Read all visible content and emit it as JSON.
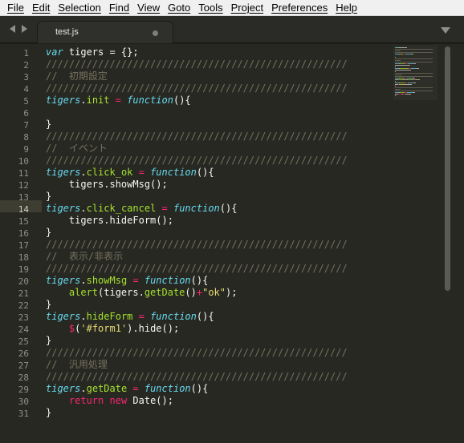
{
  "menu": [
    "File",
    "Edit",
    "Selection",
    "Find",
    "View",
    "Goto",
    "Tools",
    "Project",
    "Preferences",
    "Help"
  ],
  "tab": {
    "title": "test.js"
  },
  "current_line": 14,
  "lines": [
    {
      "n": "1",
      "t": [
        [
          "var",
          "kw"
        ],
        [
          " tigers = {};",
          ""
        ]
      ]
    },
    {
      "n": "2",
      "t": [
        [
          "////////////////////////////////////////////////////",
          "cm"
        ]
      ]
    },
    {
      "n": "3",
      "t": [
        [
          "//  初期設定",
          "cm"
        ]
      ]
    },
    {
      "n": "4",
      "t": [
        [
          "////////////////////////////////////////////////////",
          "cm"
        ]
      ]
    },
    {
      "n": "5",
      "t": [
        [
          "tigers",
          "obj"
        ],
        [
          ".",
          ""
        ],
        [
          "init",
          "fn"
        ],
        [
          " = ",
          "kw2"
        ],
        [
          "function",
          "kw"
        ],
        [
          "(){",
          ""
        ]
      ]
    },
    {
      "n": "6",
      "t": []
    },
    {
      "n": "7",
      "t": [
        [
          "}",
          ""
        ]
      ]
    },
    {
      "n": "8",
      "t": [
        [
          "////////////////////////////////////////////////////",
          "cm"
        ]
      ]
    },
    {
      "n": "9",
      "t": [
        [
          "//  イベント",
          "cm"
        ]
      ]
    },
    {
      "n": "10",
      "t": [
        [
          "////////////////////////////////////////////////////",
          "cm"
        ]
      ]
    },
    {
      "n": "11",
      "t": [
        [
          "tigers",
          "obj"
        ],
        [
          ".",
          ""
        ],
        [
          "click_ok",
          "fn"
        ],
        [
          " = ",
          "kw2"
        ],
        [
          "function",
          "kw"
        ],
        [
          "(){",
          ""
        ]
      ]
    },
    {
      "n": "12",
      "t": [
        [
          "    tigers.showMsg();",
          ""
        ]
      ]
    },
    {
      "n": "13",
      "t": [
        [
          "}",
          ""
        ]
      ]
    },
    {
      "n": "14",
      "t": [
        [
          "tigers",
          "obj"
        ],
        [
          ".",
          ""
        ],
        [
          "click_cancel",
          "fn"
        ],
        [
          " = ",
          "kw2"
        ],
        [
          "function",
          "kw"
        ],
        [
          "(){",
          ""
        ]
      ]
    },
    {
      "n": "15",
      "t": [
        [
          "    tigers.hideForm();",
          ""
        ]
      ]
    },
    {
      "n": "16",
      "t": [
        [
          "}",
          ""
        ]
      ]
    },
    {
      "n": "17",
      "t": [
        [
          "////////////////////////////////////////////////////",
          "cm"
        ]
      ]
    },
    {
      "n": "18",
      "t": [
        [
          "//  表示/非表示",
          "cm"
        ]
      ]
    },
    {
      "n": "19",
      "t": [
        [
          "////////////////////////////////////////////////////",
          "cm"
        ]
      ]
    },
    {
      "n": "20",
      "t": [
        [
          "tigers",
          "obj"
        ],
        [
          ".",
          ""
        ],
        [
          "showMsg",
          "fn"
        ],
        [
          " = ",
          "kw2"
        ],
        [
          "function",
          "kw"
        ],
        [
          "(){",
          ""
        ]
      ]
    },
    {
      "n": "21",
      "t": [
        [
          "    ",
          ""
        ],
        [
          "alert",
          "fn"
        ],
        [
          "(tigers.",
          ""
        ],
        [
          "getDate",
          "fn"
        ],
        [
          "()",
          ""
        ],
        [
          "+",
          "kw2"
        ],
        [
          "\"ok\"",
          "str"
        ],
        [
          ");",
          ""
        ]
      ]
    },
    {
      "n": "22",
      "t": [
        [
          "}",
          ""
        ]
      ]
    },
    {
      "n": "23",
      "t": [
        [
          "tigers",
          "obj"
        ],
        [
          ".",
          ""
        ],
        [
          "hideForm",
          "fn"
        ],
        [
          " = ",
          "kw2"
        ],
        [
          "function",
          "kw"
        ],
        [
          "(){",
          ""
        ]
      ]
    },
    {
      "n": "24",
      "t": [
        [
          "    ",
          ""
        ],
        [
          "$",
          "kw2"
        ],
        [
          "(",
          ""
        ],
        [
          "'#form1'",
          "str"
        ],
        [
          ").hide();",
          ""
        ]
      ]
    },
    {
      "n": "25",
      "t": [
        [
          "}",
          ""
        ]
      ]
    },
    {
      "n": "26",
      "t": [
        [
          "////////////////////////////////////////////////////",
          "cm"
        ]
      ]
    },
    {
      "n": "27",
      "t": [
        [
          "//  汎用処理",
          "cm"
        ]
      ]
    },
    {
      "n": "28",
      "t": [
        [
          "////////////////////////////////////////////////////",
          "cm"
        ]
      ]
    },
    {
      "n": "29",
      "t": [
        [
          "tigers",
          "obj"
        ],
        [
          ".",
          ""
        ],
        [
          "getDate",
          "fn"
        ],
        [
          " = ",
          "kw2"
        ],
        [
          "function",
          "kw"
        ],
        [
          "(){",
          ""
        ]
      ]
    },
    {
      "n": "30",
      "t": [
        [
          "    ",
          ""
        ],
        [
          "return",
          "kw2"
        ],
        [
          " ",
          ""
        ],
        [
          "new",
          "kw2"
        ],
        [
          " Date();",
          ""
        ]
      ]
    },
    {
      "n": "31",
      "t": [
        [
          "}",
          ""
        ]
      ]
    }
  ]
}
